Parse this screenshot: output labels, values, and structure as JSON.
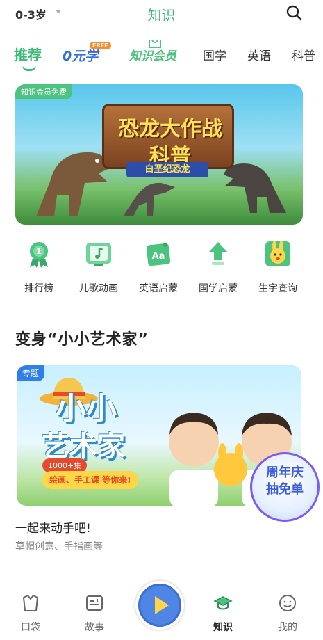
{
  "header": {
    "age_selector": "0-3岁",
    "title": "知识"
  },
  "tabs": [
    {
      "label": "推荐",
      "active": true
    },
    {
      "label": "0元学",
      "badge": "FREE"
    },
    {
      "label": "知识会员"
    },
    {
      "label": "国学"
    },
    {
      "label": "英语"
    },
    {
      "label": "科普"
    }
  ],
  "banner": {
    "badge": "知识会员免费",
    "title_line1": "恐龙大作战",
    "title_line2": "科普",
    "subtitle": "白垩纪恐龙"
  },
  "entries": [
    {
      "label": "排行榜",
      "icon": "ranking-medal-icon"
    },
    {
      "label": "儿歌动画",
      "icon": "music-note-icon"
    },
    {
      "label": "英语启蒙",
      "icon": "english-aa-icon"
    },
    {
      "label": "国学启蒙",
      "icon": "classics-icon"
    },
    {
      "label": "生字查询",
      "icon": "character-lookup-icon"
    }
  ],
  "section": {
    "title": "变身“小小艺术家”",
    "card": {
      "badge": "专题",
      "headline_line1": "小小",
      "headline_line2": "艺术家",
      "count": "1000+集",
      "strip": "绘画、手工课 等你来!",
      "promo_line1": "周年庆",
      "promo_line2": "抽免单",
      "title": "一起来动手吧!",
      "desc": "草帽创意、手指画等"
    }
  },
  "bottom_nav": [
    {
      "label": "口袋",
      "icon": "pocket-icon"
    },
    {
      "label": "故事",
      "icon": "story-icon"
    },
    {
      "label": "知识",
      "icon": "knowledge-cap-icon",
      "active": true
    },
    {
      "label": "我的",
      "icon": "profile-icon"
    }
  ],
  "colors": {
    "accent": "#3cb878",
    "text": "#222222",
    "muted": "#888888"
  }
}
